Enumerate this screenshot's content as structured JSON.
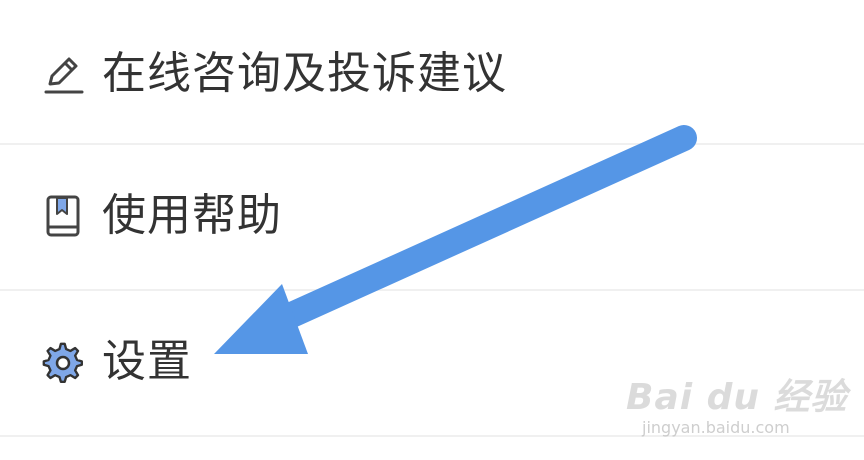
{
  "menu": {
    "items": [
      {
        "label": "在线咨询及投诉建议",
        "icon": "pencil-icon"
      },
      {
        "label": "使用帮助",
        "icon": "help-book-icon"
      },
      {
        "label": "设置",
        "icon": "gear-icon"
      }
    ]
  },
  "annotation": {
    "arrow_color": "#5596e6",
    "target": "设置"
  },
  "watermark": {
    "brand": "Bai du 经验",
    "url": "jingyan.baidu.com"
  },
  "colors": {
    "text": "#333333",
    "divider": "#f0f0f0",
    "icon_accent": "#7fa7e8"
  }
}
